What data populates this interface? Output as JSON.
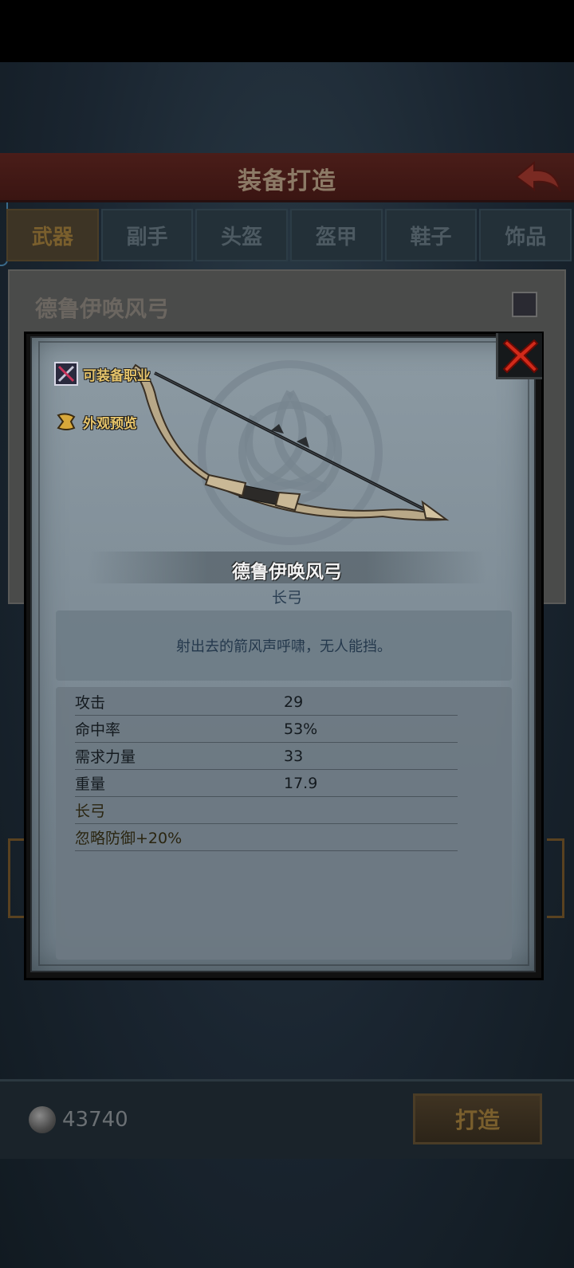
{
  "background": {
    "header_title": "装备打造",
    "tabs": [
      "武器",
      "副手",
      "头盔",
      "盔甲",
      "鞋子",
      "饰品"
    ],
    "active_tab": 0,
    "item_name": "德鲁伊唤风弓",
    "coins": "43740",
    "craft_button": "打造"
  },
  "modal": {
    "equip_class_label": "可装备职业",
    "preview_label": "外观预览",
    "item_name": "德鲁伊唤风弓",
    "item_type": "长弓",
    "description": "射出去的箭风声呼啸，无人能挡。",
    "stats": [
      {
        "key": "攻击",
        "value": "29"
      },
      {
        "key": "命中率",
        "value": "53%"
      },
      {
        "key": "需求力量",
        "value": "33"
      },
      {
        "key": "重量",
        "value": "17.9"
      }
    ],
    "specials": [
      "长弓",
      "忽略防御+20%"
    ]
  },
  "colors": {
    "gold_label": "#e6c46b",
    "close_red": "#d12a1a",
    "modal_bg": "#8c9aa3"
  },
  "icons": {
    "close": "close-x-icon",
    "equip_class": "crossed-weapons-icon",
    "preview": "preview-icon",
    "coin": "coin-icon",
    "back": "back-arrow-icon"
  }
}
